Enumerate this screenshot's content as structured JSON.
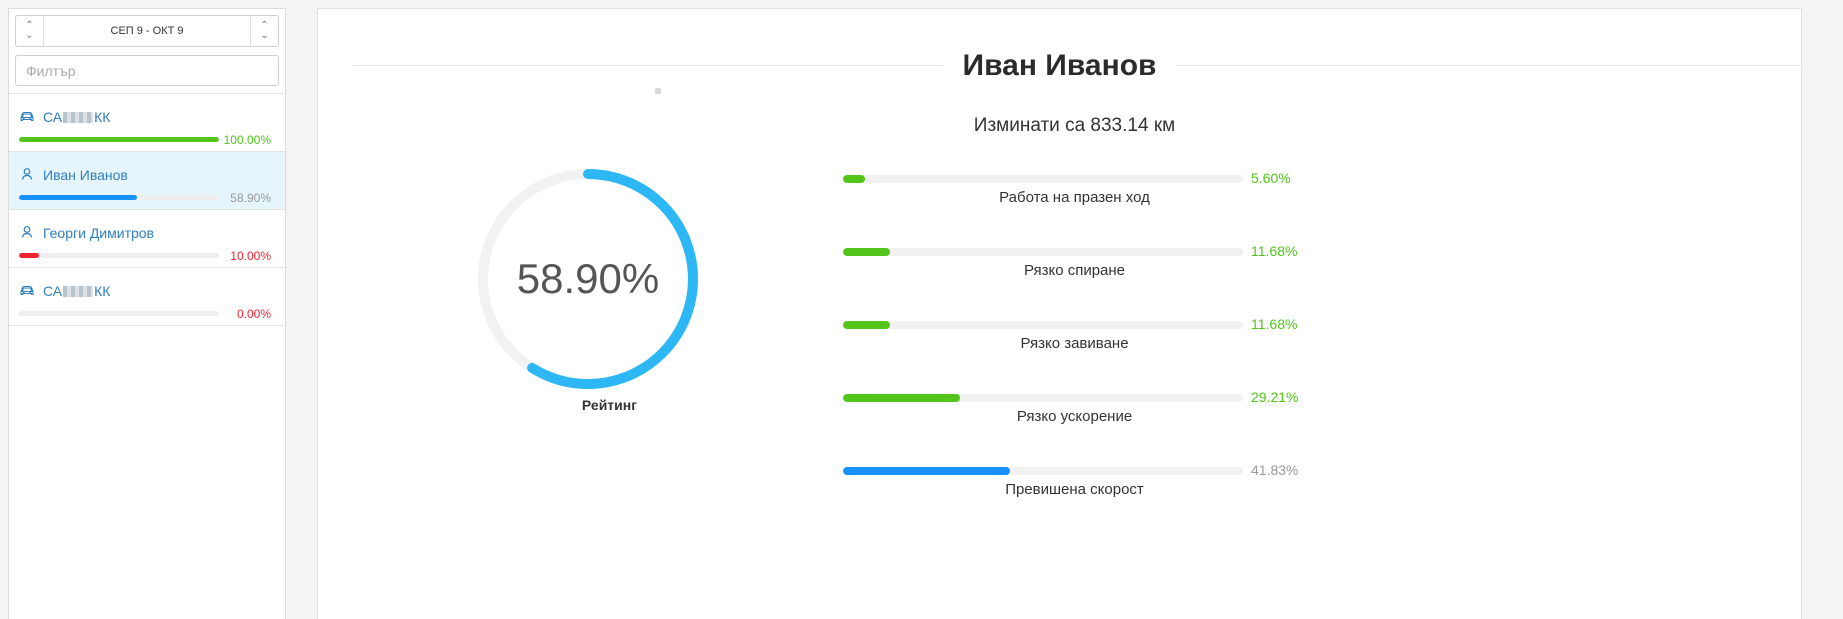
{
  "colors": {
    "green": "#52c41a",
    "blue": "#1890ff",
    "red": "#f5222d",
    "gray": "#999999",
    "gauge": "#2db7f5",
    "link": "#2f7fbf"
  },
  "sidebar": {
    "date_range": "СЕП 9 - ОКТ 9",
    "filter_placeholder": "Филтър",
    "items": [
      {
        "type": "vehicle",
        "icon": "car-icon",
        "name_prefix": "СА",
        "name_suffix": "КК",
        "redacted": true,
        "percent_text": "100.00%",
        "value": 100.0,
        "color": "#52c41a",
        "pct_color": "#52c41a",
        "active": false
      },
      {
        "type": "driver",
        "icon": "user-icon",
        "name": "Иван Иванов",
        "percent_text": "58.90%",
        "value": 58.9,
        "color": "#1890ff",
        "pct_color": "#999999",
        "active": true
      },
      {
        "type": "driver",
        "icon": "user-icon",
        "name": "Георги Димитров",
        "percent_text": "10.00%",
        "value": 10.0,
        "color": "#f5222d",
        "pct_color": "#f5222d",
        "active": false
      },
      {
        "type": "vehicle",
        "icon": "car-icon",
        "name_prefix": "СА",
        "name_suffix": "КК",
        "redacted": true,
        "percent_text": "0.00%",
        "value": 0.0,
        "color": "#f5222d",
        "pct_color": "#f5222d",
        "active": false
      }
    ]
  },
  "main": {
    "title": "Иван Иванов",
    "distance": "Изминати са 833.14 км",
    "rating": {
      "value": 58.9,
      "text": "58.90%",
      "label": "Рейтинг"
    },
    "metrics": [
      {
        "label": "Работа на празен ход",
        "value": 5.6,
        "text": "5.60%",
        "color": "#52c41a",
        "pct_color": "#52c41a"
      },
      {
        "label": "Рязко спиране",
        "value": 11.68,
        "text": "11.68%",
        "color": "#52c41a",
        "pct_color": "#52c41a"
      },
      {
        "label": "Рязко завиване",
        "value": 11.68,
        "text": "11.68%",
        "color": "#52c41a",
        "pct_color": "#52c41a"
      },
      {
        "label": "Рязко ускорение",
        "value": 29.21,
        "text": "29.21%",
        "color": "#52c41a",
        "pct_color": "#52c41a"
      },
      {
        "label": "Превишена скорост",
        "value": 41.83,
        "text": "41.83%",
        "color": "#1890ff",
        "pct_color": "#999999"
      }
    ]
  }
}
